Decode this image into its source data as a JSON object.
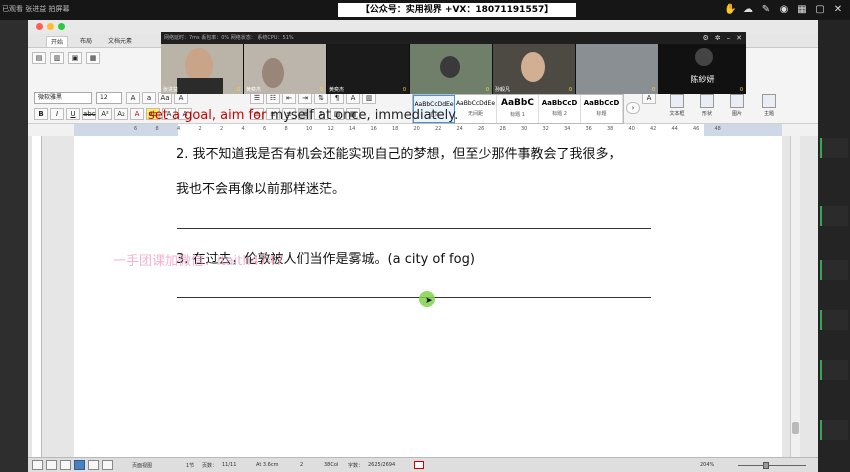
{
  "top_bar": {
    "left_title": "已观看 张进益 拍屏幕",
    "watermark": "【公众号：实用视界 +VX：18071191557】",
    "tools": [
      "hand-icon",
      "cloud-icon",
      "pen-icon",
      "eye-icon",
      "grid-icon",
      "window-icon",
      "close-icon"
    ]
  },
  "video_panel": {
    "status": "网络延时：7ms  丢包率：0%  网络状态：  系统CPU：51%",
    "participants": [
      {
        "name": "张进益",
        "score": "0"
      },
      {
        "name": "黄奕杰",
        "score": "0"
      },
      {
        "name": "黄奕杰",
        "score": "0"
      },
      {
        "name": "",
        "score": "0"
      },
      {
        "name": "孙毅凡",
        "score": "0"
      },
      {
        "name": "",
        "score": "0"
      },
      {
        "name": "陈紗妍",
        "score": "0"
      }
    ]
  },
  "ribbon": {
    "tabs": [
      "开始",
      "布局",
      "文档元素"
    ],
    "font_name": "微软雅黑",
    "font_size": "12",
    "styles": [
      {
        "sample": "AaBbCcDdEe",
        "name": "正文"
      },
      {
        "sample": "AaBbCcDdEe",
        "name": "无间距"
      },
      {
        "sample": "AaBbC",
        "name": "标题 1"
      },
      {
        "sample": "AaBbCcD",
        "name": "标题 2"
      },
      {
        "sample": "AaBbCcD",
        "name": "标题"
      }
    ],
    "right_groups": [
      "文本框",
      "形状",
      "图片",
      "主题"
    ]
  },
  "ruler": {
    "numbers": [
      "6",
      "8",
      "4",
      "2",
      "2",
      "4",
      "6",
      "8",
      "10",
      "12",
      "14",
      "16",
      "18",
      "20",
      "22",
      "24",
      "26",
      "28",
      "30",
      "32",
      "34",
      "36",
      "38",
      "40",
      "42",
      "44",
      "46",
      "48"
    ]
  },
  "document": {
    "cut_line_red": "set a goal, aim for",
    "cut_line_black": " myself at once, immediately.",
    "line2a": "2. 我不知道我是否有机会还能实现自己的梦想，但至少那件事教会了我很多，",
    "line2b": "我也不会再像以前那样迷茫。",
    "line3": "3. 在过去，伦敦被人们当作是雾城。(a city of fog)",
    "pink_watermark": "一手团课加微信：itaith4747"
  },
  "status_bar": {
    "view": "页面视图",
    "section": "1节",
    "pages_label": "页数：",
    "pages": "11/11",
    "position": "At 3.6cm",
    "line": "2",
    "col": "38Col",
    "words_label": "字数：",
    "words": "2625/2694",
    "zoom": "204%"
  }
}
